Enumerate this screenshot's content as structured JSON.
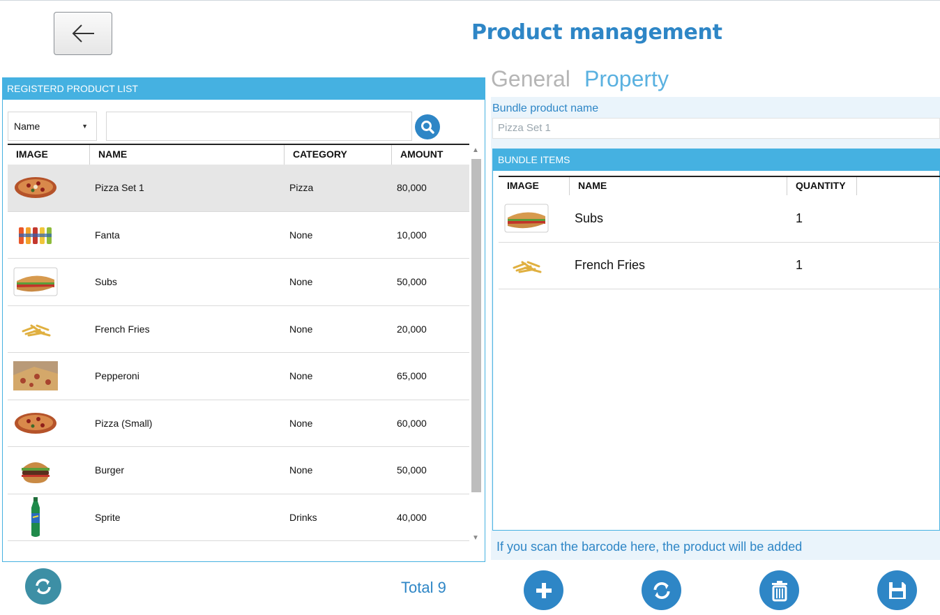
{
  "header": {
    "title": "Product management",
    "back_icon": "arrow-left-icon"
  },
  "product_list": {
    "title": "REGISTERD PRODUCT LIST",
    "filter": {
      "selected": "Name"
    },
    "search": {
      "value": "",
      "placeholder": ""
    },
    "columns": [
      "IMAGE",
      "NAME",
      "CATEGORY",
      "AMOUNT"
    ],
    "rows": [
      {
        "image": "pizza",
        "name": "Pizza Set 1",
        "category": "Pizza",
        "amount": "80,000"
      },
      {
        "image": "fanta-bottles",
        "name": "Fanta",
        "category": "None",
        "amount": "10,000"
      },
      {
        "image": "sub-sandwich",
        "name": "Subs",
        "category": "None",
        "amount": "50,000"
      },
      {
        "image": "french-fries",
        "name": "French Fries",
        "category": "None",
        "amount": "20,000"
      },
      {
        "image": "pepperoni-pizza",
        "name": "Pepperoni",
        "category": "None",
        "amount": "65,000"
      },
      {
        "image": "pizza",
        "name": "Pizza (Small)",
        "category": "None",
        "amount": "60,000"
      },
      {
        "image": "burger",
        "name": "Burger",
        "category": "None",
        "amount": "50,000"
      },
      {
        "image": "sprite-bottle",
        "name": "Sprite",
        "category": "Drinks",
        "amount": "40,000"
      }
    ]
  },
  "detail": {
    "tabs": {
      "general": "General",
      "property": "Property"
    },
    "bundle_name_label": "Bundle product name",
    "bundle_name_value": "Pizza Set 1",
    "bundle_items_title": "BUNDLE ITEMS",
    "bundle_columns": [
      "IMAGE",
      "NAME",
      "QUANTITY"
    ],
    "bundle_items": [
      {
        "image": "sub-sandwich",
        "name": "Subs",
        "quantity": "1"
      },
      {
        "image": "french-fries",
        "name": "French Fries",
        "quantity": "1"
      }
    ],
    "scan_hint": "If you scan the barcode here, the product will be added"
  },
  "footer": {
    "total": "Total 9"
  },
  "colors": {
    "accent": "#45b1e1",
    "title": "#2e86c6",
    "teal_button": "#3d8fa5"
  }
}
